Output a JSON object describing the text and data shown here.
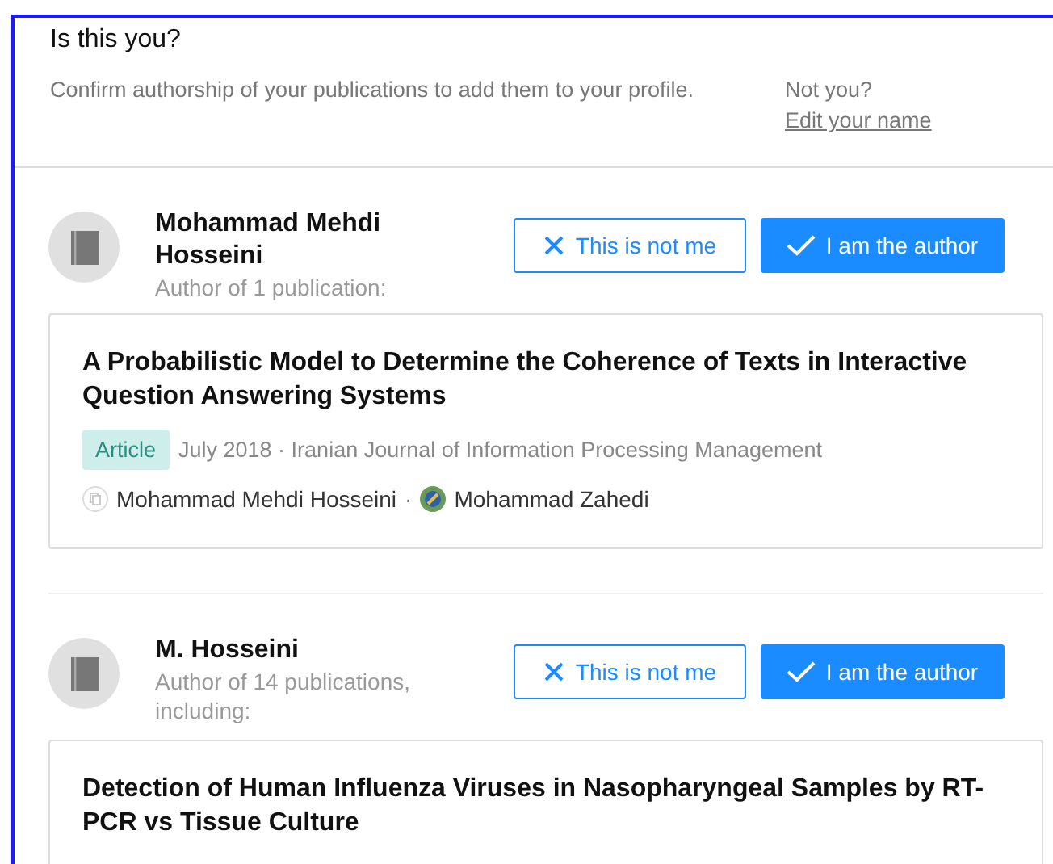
{
  "header": {
    "title": "Is this you?",
    "subtitle": "Confirm authorship of your publications to add them to your profile.",
    "aside_label": "Not you?",
    "aside_link": "Edit your name"
  },
  "authors": [
    {
      "name": "Mohammad Mehdi Hosseini",
      "count": "Author of 1 publication:",
      "reject_button": "This is not me",
      "confirm_button": "I am the author",
      "publication": {
        "title": "A Probabilistic Model to Determine the Coherence of Texts in Interactive Question Answering Systems",
        "type": "Article",
        "meta": "July 2018 · Iranian Journal of Information Processing Management",
        "author_separator": "·",
        "authors": [
          {
            "name": "Mohammad Mehdi Hosseini",
            "kind": "placeholder"
          },
          {
            "name": "Mohammad Zahedi",
            "kind": "photo"
          }
        ]
      }
    },
    {
      "name": "M. Hosseini",
      "count": "Author of 14 publications, including:",
      "reject_button": "This is not me",
      "confirm_button": "I am the author",
      "publication": {
        "title": "Detection of Human Influenza Viruses in Nasopharyngeal Samples by RT-PCR vs Tissue Culture"
      }
    }
  ]
}
